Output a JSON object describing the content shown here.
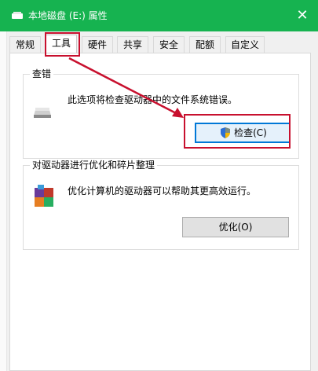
{
  "window": {
    "title": "本地磁盘 (E:) 属性",
    "close_glyph": "✕"
  },
  "tabs": [
    {
      "label": "常规",
      "active": false
    },
    {
      "label": "工具",
      "active": true
    },
    {
      "label": "硬件",
      "active": false
    },
    {
      "label": "共享",
      "active": false
    },
    {
      "label": "安全",
      "active": false
    },
    {
      "label": "配额",
      "active": false
    },
    {
      "label": "自定义",
      "active": false
    }
  ],
  "error_check": {
    "title": "查错",
    "description": "此选项将检查驱动器中的文件系统错误。",
    "button_label": "检查(C)",
    "icon": "drive-icon"
  },
  "optimize": {
    "title": "对驱动器进行优化和碎片整理",
    "description": "优化计算机的驱动器可以帮助其更高效运行。",
    "button_label": "优化(O)",
    "icon": "defrag-icon"
  },
  "colors": {
    "titlebar": "#16b350",
    "highlight": "#c8102e",
    "button_focus": "#0078d7"
  }
}
